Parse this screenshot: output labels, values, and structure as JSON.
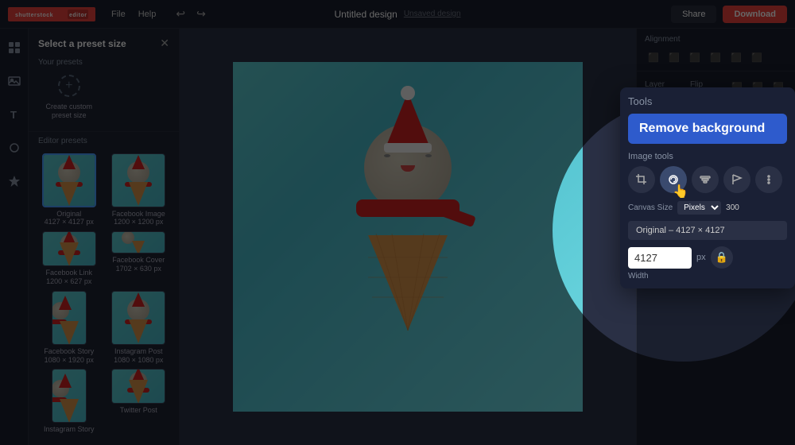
{
  "topbar": {
    "logo": "shutterstock editor",
    "editor_badge": "editor",
    "menu_items": [
      "File",
      "Help"
    ],
    "title": "Untitled design",
    "unsaved_label": "Unsaved design",
    "share_label": "Share",
    "download_label": "Download"
  },
  "left_panel": {
    "title": "Select a preset size",
    "your_presets_label": "Your presets",
    "create_custom_label": "Create custom preset size",
    "editor_presets_label": "Editor presets",
    "presets": [
      {
        "label": "Original\n4127 × 4127 px",
        "active": true
      },
      {
        "label": "Facebook Image\n1200 × 1200 px",
        "active": false
      },
      {
        "label": "Facebook Link\n1200 × 627 px",
        "active": false
      },
      {
        "label": "Facebook Cover\n1702 × 630 px",
        "active": false
      },
      {
        "label": "Facebook Story\n1080 × 1920 px",
        "active": false
      },
      {
        "label": "Instagram Post\n1080 × 1080 px",
        "active": false
      },
      {
        "label": "Instagram Story",
        "active": false
      },
      {
        "label": "Twitter Post",
        "active": false
      }
    ]
  },
  "right_panel": {
    "alignment_title": "Alignment",
    "layer_title": "Layer",
    "flip_label": "Flip"
  },
  "tools_panel": {
    "tools_title": "Tools",
    "remove_bg_label": "Remove background",
    "image_tools_title": "Image tools",
    "canvas_size_label": "Canvas Size",
    "pixels_label": "Pixels",
    "canvas_size_value": "300",
    "original_label": "Original – 4127 × 4127",
    "dimension_value": "4127",
    "dimension_unit": "px",
    "width_label": "Width"
  }
}
